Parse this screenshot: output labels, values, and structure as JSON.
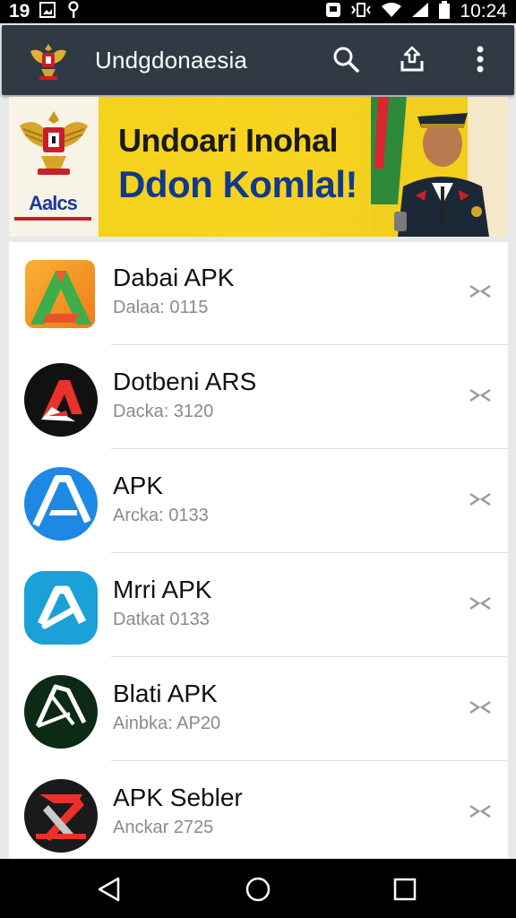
{
  "status_bar": {
    "left_time": "19",
    "time": "10:24",
    "icons": [
      "image-icon",
      "vpn-key-icon",
      "photo-icon",
      "vibrate-icon",
      "wifi-icon",
      "signal-icon",
      "battery-icon"
    ]
  },
  "app_bar": {
    "title": "Undgdonaesia",
    "logo_icon": "garuda-emblem-icon",
    "actions": [
      "search-icon",
      "share-upload-icon",
      "more-vert-icon"
    ]
  },
  "banner": {
    "line1": "Undoari Inohal",
    "line2": "Ddon Komlal!",
    "badge": "Aalcs"
  },
  "apps": [
    {
      "title": "Dabai APK",
      "subtitle": "Dalaa: 0115",
      "icon": "orange-a-app-icon"
    },
    {
      "title": "Dotbeni ARS",
      "subtitle": "Dacka: 3120",
      "icon": "black-red-a-app-icon"
    },
    {
      "title": "APK",
      "subtitle": "Arcka: 0133",
      "icon": "blue-a-app-icon"
    },
    {
      "title": "Mrri APK",
      "subtitle": "Datkat 0133",
      "icon": "cyan-a-app-icon"
    },
    {
      "title": "Blati APK",
      "subtitle": "Ainbka: AP20",
      "icon": "green-black-a-app-icon"
    },
    {
      "title": "APK Sebler",
      "subtitle": "Anckar 2725",
      "icon": "red-x-app-icon"
    }
  ],
  "nav": [
    "back-icon",
    "home-icon",
    "recents-icon"
  ],
  "colors": {
    "app_bar": "#2f3a45",
    "banner_yellow": "#f4d21a",
    "banner_blue_text": "#123a8a"
  }
}
